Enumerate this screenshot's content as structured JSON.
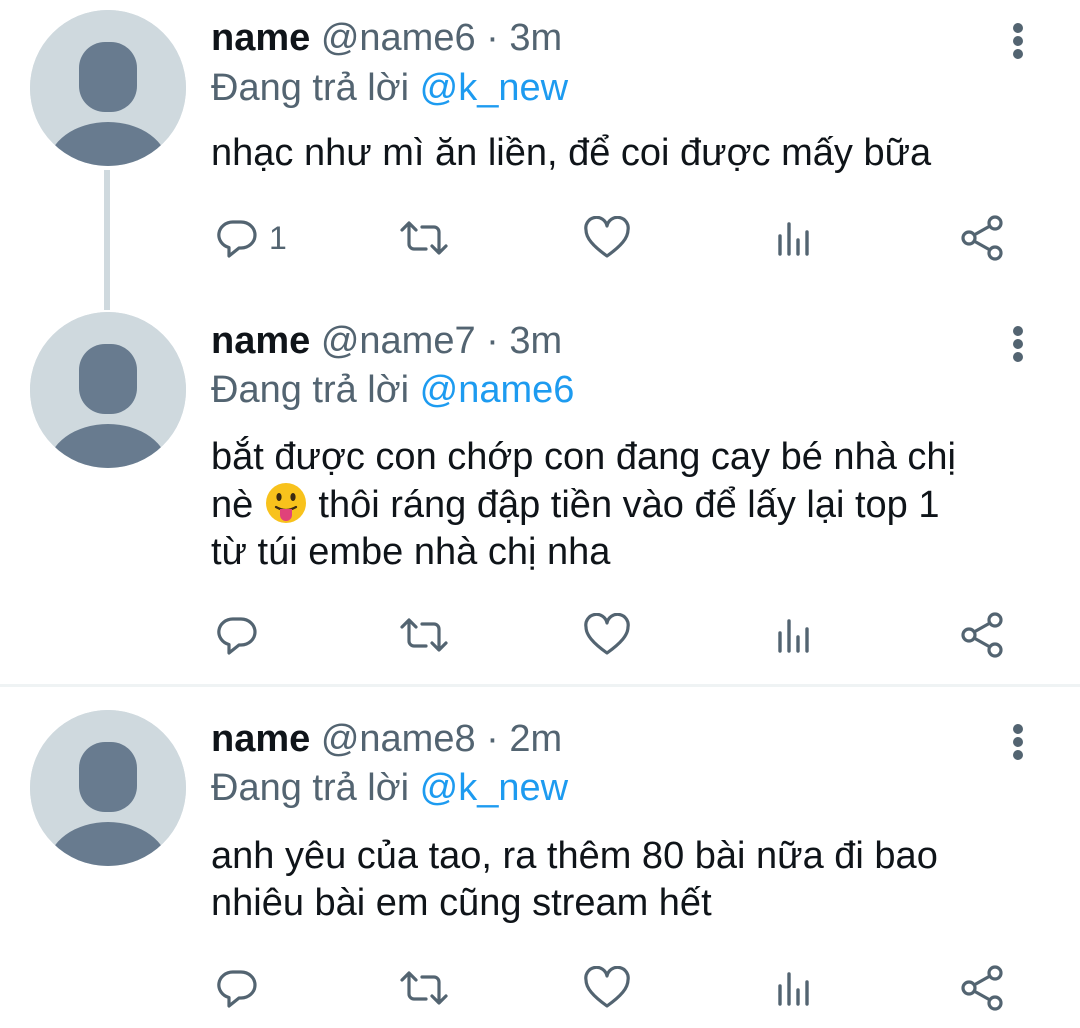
{
  "tweets": [
    {
      "name": "name",
      "handle": "@name6",
      "separator": "·",
      "time": "3m",
      "replying_prefix": "Đang trả lời",
      "replying_to": "@k_new",
      "text_lines": [
        "nhạc như mì ăn liền, để coi được mấy bữa"
      ],
      "reply_count": "1"
    },
    {
      "name": "name",
      "handle": "@name7",
      "separator": "·",
      "time": "3m",
      "replying_prefix": "Đang trả lời",
      "replying_to": "@name6",
      "text_lines": [
        "bắt được con chớp con đang cay bé nhà chị",
        "nè",
        "thôi ráng đập tiền vào để lấy lại top 1",
        "từ túi embe nhà chị nha"
      ],
      "emoji": "😛",
      "reply_count": ""
    },
    {
      "name": "name",
      "handle": "@name8",
      "separator": "·",
      "time": "2m",
      "replying_prefix": "Đang trả lời",
      "replying_to": "@k_new",
      "text_lines": [
        "anh yêu của tao, ra thêm 80 bài nữa đi bao",
        "nhiêu bài em cũng stream hết"
      ],
      "reply_count": ""
    }
  ],
  "icons": {
    "reply": "reply-icon",
    "retweet": "retweet-icon",
    "like": "heart-icon",
    "analytics": "analytics-icon",
    "share": "share-icon",
    "more": "more-vertical-icon"
  },
  "colors": {
    "text": "#0f1419",
    "secondary": "#536471",
    "accent": "#1d9bf0",
    "avatar_bg": "#cfd9de",
    "avatar_fg": "#687b8f"
  }
}
